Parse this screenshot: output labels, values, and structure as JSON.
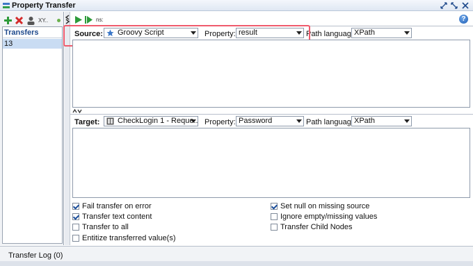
{
  "window": {
    "title": "Property Transfer"
  },
  "left": {
    "toolbar_extra_label": "XY..",
    "transfers_header": "Transfers",
    "items": [
      "13"
    ]
  },
  "right_toolbar": {
    "ns_label": "ns:"
  },
  "source": {
    "label": "Source:",
    "value": "Groovy Script",
    "property_label": "Property:",
    "property_value": "result",
    "path_language_label": "Path language:",
    "path_language_value": "XPath"
  },
  "target": {
    "label": "Target:",
    "value": "CheckLogin 1 - Reque...",
    "property_label": "Property:",
    "property_value": "Password",
    "path_language_label": "Path language:",
    "path_language_value": "XPath"
  },
  "options": {
    "left": [
      {
        "label": "Fail transfer on error",
        "checked": true
      },
      {
        "label": "Transfer text content",
        "checked": true
      },
      {
        "label": "Transfer to all",
        "checked": false
      },
      {
        "label": "Entitize transferred value(s)",
        "checked": false
      }
    ],
    "right": [
      {
        "label": "Set null on missing source",
        "checked": true
      },
      {
        "label": "Ignore empty/missing values",
        "checked": false
      },
      {
        "label": "Transfer Child Nodes",
        "checked": false
      }
    ]
  },
  "log": {
    "label": "Transfer Log (0)"
  },
  "colors": {
    "highlight": "#ef5a6c",
    "selection": "#c9dcf3",
    "header_text": "#1f4a8c"
  },
  "icons": [
    "property-transfer-icon",
    "restore-icon",
    "close-icon",
    "add-icon",
    "delete-icon",
    "user-icon",
    "run-icon",
    "run-all-icon",
    "help-icon",
    "star-icon",
    "test-request-icon"
  ]
}
